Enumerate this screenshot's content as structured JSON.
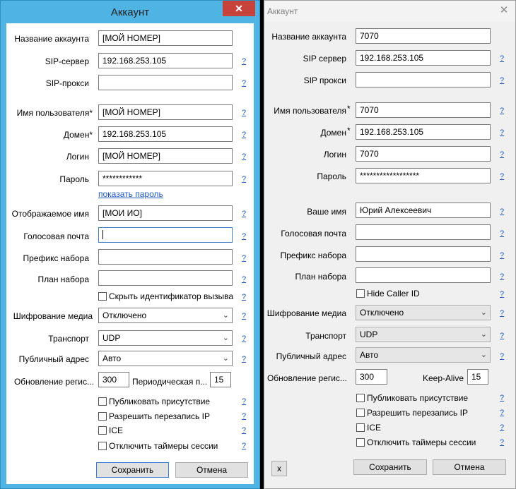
{
  "left": {
    "title": "Аккаунт",
    "close": "✕",
    "labels": {
      "account_name": "Название аккаунта",
      "sip_server": "SIP-сервер",
      "sip_proxy": "SIP-прокси",
      "username": "Имя пользователя*",
      "domain": "Домен*",
      "login": "Логин",
      "password": "Пароль",
      "display_name": "Отображаемое имя",
      "voicemail": "Голосовая почта",
      "dial_prefix": "Префикс набора",
      "dial_plan": "План набора",
      "media_encryption": "Шифрование медиа",
      "transport": "Транспорт",
      "public_address": "Публичный адрес",
      "registration_refresh": "Обновление регис...",
      "periodic": "Периодическая п..."
    },
    "values": {
      "account_name": "[МОЙ НОМЕР]",
      "sip_server": "192.168.253.105",
      "sip_proxy": "",
      "username": "[МОЙ НОМЕР]",
      "domain": "192.168.253.105",
      "login": "[МОЙ НОМЕР]",
      "password": "************",
      "display_name": "[МОИ ИО]",
      "voicemail": "",
      "dial_prefix": "",
      "dial_plan": "",
      "media_encryption": "Отключено",
      "transport": "UDP",
      "public_address": "Авто",
      "registration_refresh": "300",
      "periodic": "15"
    },
    "show_password": "показать пароль",
    "help": "?",
    "checkboxes": {
      "hide_caller_id": "Скрыть идентификатор вызываю",
      "publish_presence": "Публиковать присутствие",
      "allow_ip_rewrite": "Разрешить перезапись IP",
      "ice": "ICE",
      "disable_session_timers": "Отключить таймеры сессии"
    },
    "buttons": {
      "save": "Сохранить",
      "cancel": "Отмена"
    }
  },
  "right": {
    "title": "Аккаунт",
    "close": "✕",
    "labels": {
      "account_name": "Название аккаунта",
      "sip_server": "SIP сервер",
      "sip_proxy": "SIP прокси",
      "username": "Имя пользователя",
      "domain": "Домен",
      "login": "Логин",
      "password": "Пароль",
      "your_name": "Ваше имя",
      "voicemail": "Голосовая почта",
      "dial_prefix": "Префикс набора",
      "dial_plan": "План набора",
      "media_encryption": "Шифрование медиа",
      "transport": "Транспорт",
      "public_address": "Публичный адрес",
      "registration_refresh": "Обновление регис...",
      "keep_alive": "Keep-Alive"
    },
    "required_mark": "*",
    "values": {
      "account_name": "7070",
      "sip_server": "192.168.253.105",
      "sip_proxy": "",
      "username": "7070",
      "domain": "192.168.253.105",
      "login": "7070",
      "password": "******************",
      "your_name": "Юрий Алексеевич",
      "voicemail": "",
      "dial_prefix": "",
      "dial_plan": "",
      "media_encryption": "Отключено",
      "transport": "UDP",
      "public_address": "Авто",
      "registration_refresh": "300",
      "keep_alive": "15"
    },
    "help": "?",
    "checkboxes": {
      "hide_caller_id": "Hide Caller ID",
      "publish_presence": "Публиковать присутствие",
      "allow_ip_rewrite": "Разрешить перезапись IP",
      "ice": "ICE",
      "disable_session_timers": "Отключить таймеры сессии"
    },
    "buttons": {
      "x": "x",
      "save": "Сохранить",
      "cancel": "Отмена"
    }
  }
}
